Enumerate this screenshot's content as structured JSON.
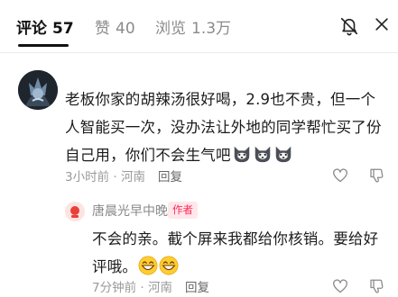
{
  "tabs": [
    {
      "label": "评论",
      "count": "57",
      "active": true
    },
    {
      "label": "赞",
      "count": "40",
      "active": false
    },
    {
      "label": "浏览",
      "count": "1.3万",
      "active": false
    }
  ],
  "icons": {
    "mute": "bell-muted-icon",
    "close": "close-icon",
    "like": "heart-outline-icon",
    "dislike": "thumb-down-outline-icon",
    "emoji_1": "husky-emoji",
    "emoji_2": "grin-emoji"
  },
  "comments": [
    {
      "text": "老板你家的胡辣汤很好喝，2.9也不贵，但一个人智能买一次，没办法让外地的同学帮忙买了份自己用，你们不会生气吧",
      "emoji_count": 3,
      "time": "3小时前",
      "location": "河南",
      "reply_label": "回复"
    },
    {
      "author": "唐晨光早中晚餐",
      "author_badge": "作者",
      "text_part1": "不会的亲。截个屏来我都给你核销。要给好评哦。",
      "emoji_count": 2,
      "time": "7分钟前",
      "location": "河南",
      "reply_label": "回复"
    }
  ],
  "colors": {
    "accent": "#fe2c55",
    "muted_text": "#9a9a9a",
    "badge_bg": "#ffe7ec"
  }
}
